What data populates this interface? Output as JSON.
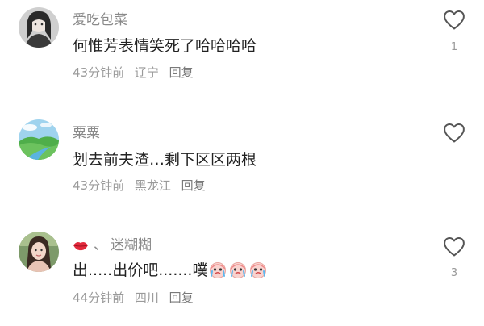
{
  "comments": [
    {
      "username": "爱吃包菜",
      "text": "何惟芳表情笑死了哈哈哈哈",
      "time": "43分钟前",
      "location": "辽宁",
      "reply_label": "回复",
      "like_count": "1",
      "avatar_icon": "avatar-girl-photo"
    },
    {
      "username": "粟粟",
      "text": "划去前夫渣…剩下区区两根",
      "time": "43分钟前",
      "location": "黑龙江",
      "reply_label": "回复",
      "like_count": "",
      "avatar_icon": "avatar-landscape-photo"
    },
    {
      "username": "迷糊糊",
      "username_prefix_icon": "lips-emoji",
      "username_separator": "、",
      "text": "出.....出价吧.......噗",
      "text_suffix_emojis": [
        "crying-emoji",
        "crying-emoji",
        "crying-emoji"
      ],
      "time": "44分钟前",
      "location": "四川",
      "reply_label": "回复",
      "like_count": "3",
      "avatar_icon": "avatar-girl-outdoor-photo"
    }
  ],
  "colors": {
    "username": "#8a8a8a",
    "text": "#222222",
    "meta": "#9a9a9a",
    "heart_outline": "#555555"
  }
}
